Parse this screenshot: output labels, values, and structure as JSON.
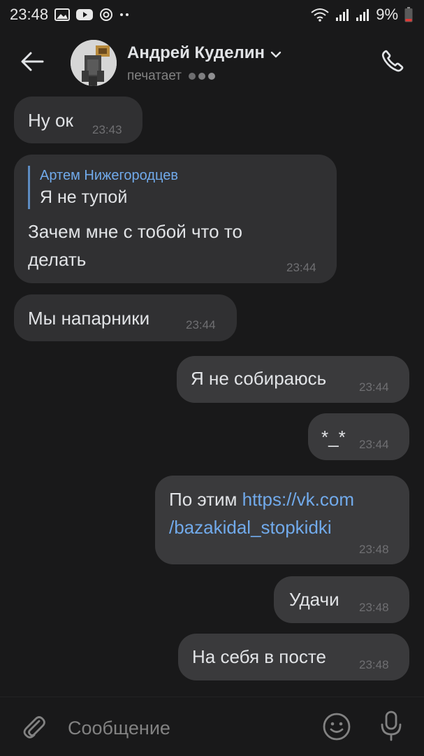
{
  "status_bar": {
    "time": "23:48",
    "battery": "9%",
    "left_icons": [
      "gallery-icon",
      "youtube-icon",
      "vpn-icon",
      "more-dots-icon"
    ],
    "right_icons": [
      "wifi-icon",
      "signal-icon",
      "signal-icon",
      "battery-icon"
    ]
  },
  "header": {
    "contact_name": "Андрей Куделин",
    "status": "печатает",
    "icons": [
      "back-arrow-icon",
      "chevron-down-icon",
      "phone-icon"
    ]
  },
  "messages": [
    {
      "direction": "in",
      "text": "Ну ок",
      "time": "23:43"
    },
    {
      "direction": "in",
      "reply_author": "Артем Нижегородцев",
      "reply_text": "Я не тупой",
      "text_lines": [
        "Зачем мне с тобой что то",
        "делать"
      ],
      "time": "23:44"
    },
    {
      "direction": "in",
      "text": "Мы напарники",
      "time": "23:44"
    },
    {
      "direction": "out",
      "text": "Я не собираюсь",
      "time": "23:44"
    },
    {
      "direction": "out",
      "text": "*_*",
      "time": "23:44"
    },
    {
      "direction": "out",
      "text_prefix": "По этим ",
      "link_line1": "https://vk.com",
      "link_line2": "/bazakidal_stopkidki",
      "time": "23:48"
    },
    {
      "direction": "out",
      "text": "Удачи",
      "time": "23:48"
    },
    {
      "direction": "out",
      "text": "На себя в посте",
      "time": "23:48"
    }
  ],
  "composer": {
    "placeholder": "Сообщение",
    "icons": [
      "paperclip-icon",
      "emoji-icon",
      "microphone-icon"
    ]
  },
  "colors": {
    "background": "#19191a",
    "incoming_bubble": "#303032",
    "outgoing_bubble": "#3a3a3c",
    "accent": "#71aaeb",
    "secondary_text": "#828282"
  }
}
